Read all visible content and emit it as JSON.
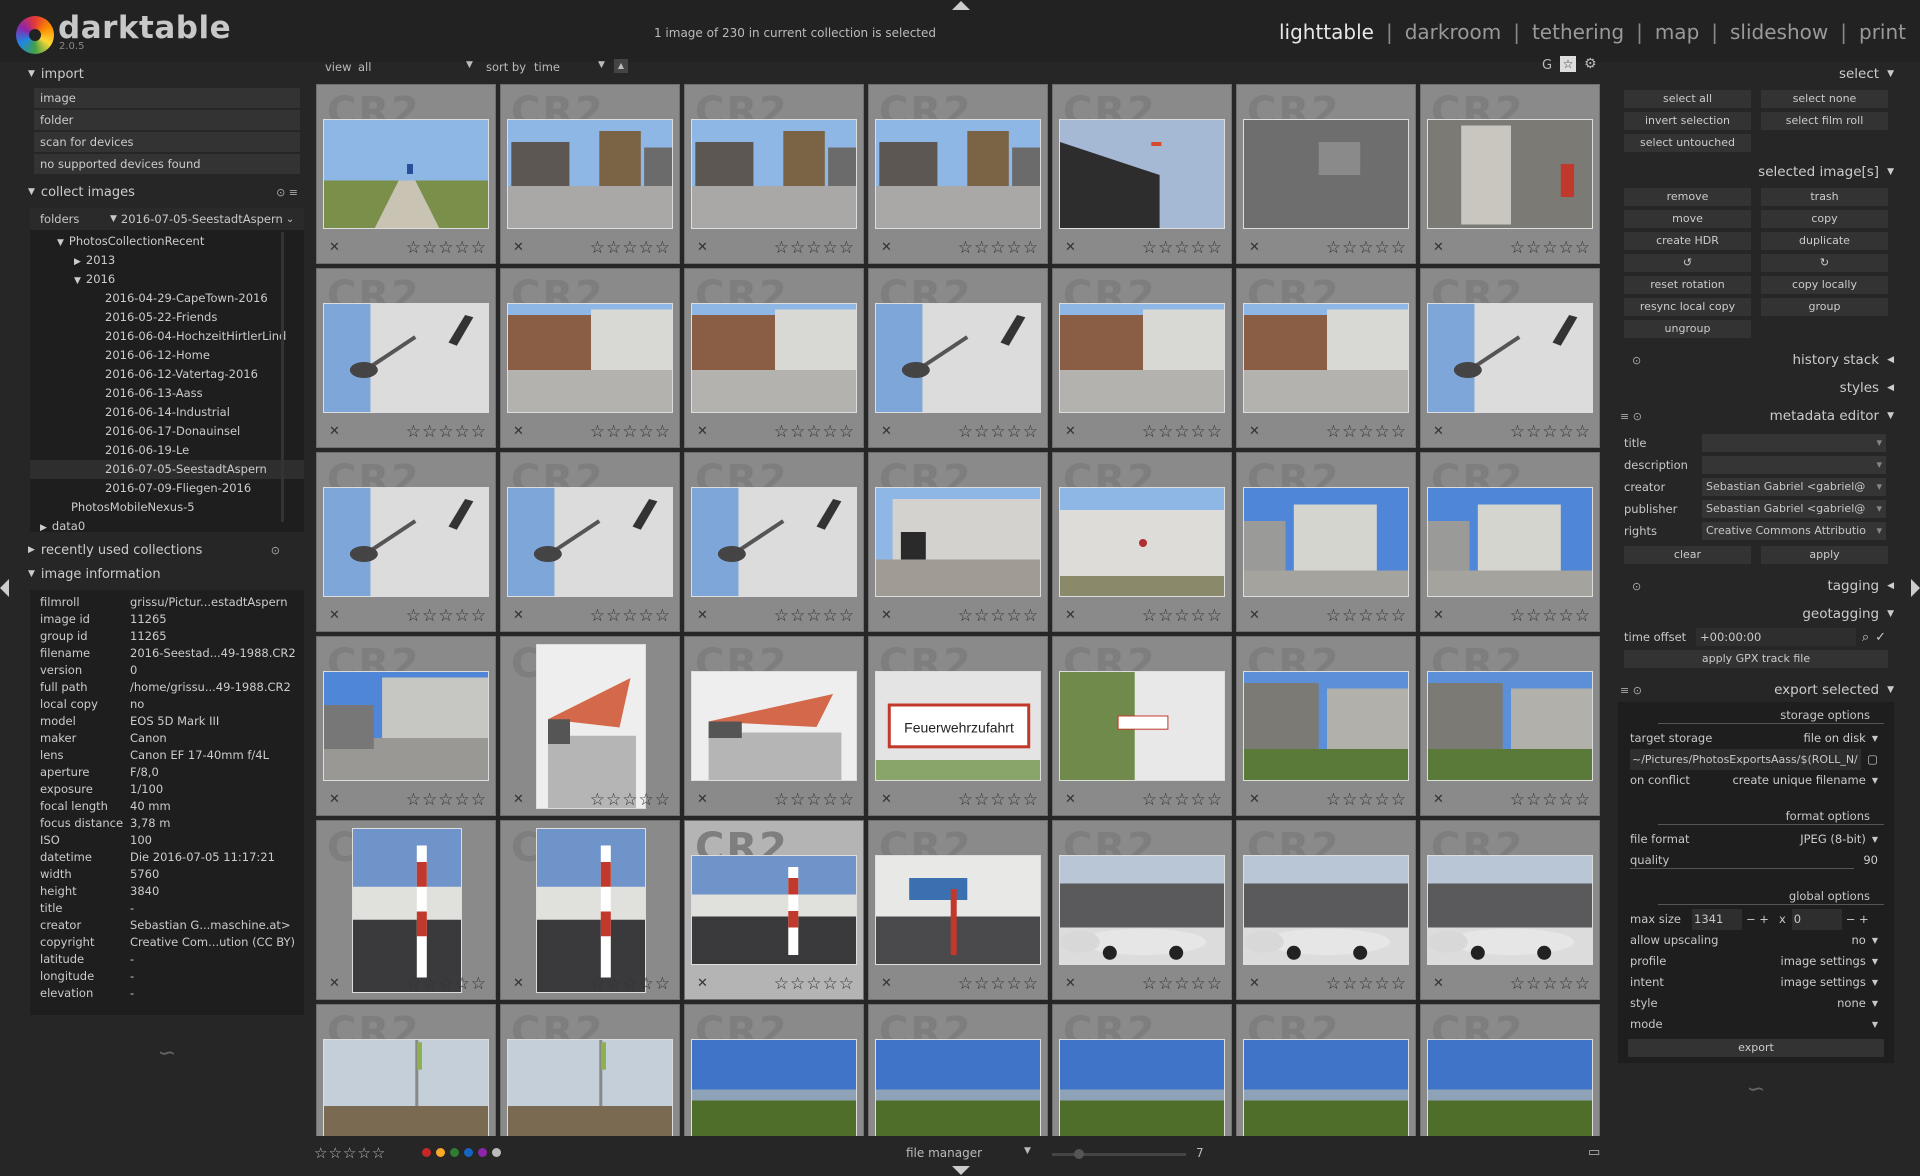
{
  "app": {
    "name": "darktable",
    "version": "2.0.5"
  },
  "status": "1 image of 230 in current collection is selected",
  "views": [
    "lighttable",
    "darkroom",
    "tethering",
    "map",
    "slideshow",
    "print"
  ],
  "active_view": "lighttable",
  "left": {
    "import": {
      "title": "import",
      "buttons": [
        "image",
        "folder",
        "scan for devices",
        "no supported devices found"
      ]
    },
    "collect": {
      "title": "collect images",
      "property": "folders",
      "value": "2016-07-05-SeestadtAspern",
      "tree": [
        {
          "label": "PhotosCollectionRecent",
          "level": 1,
          "arrow": "▼"
        },
        {
          "label": "2013",
          "level": 2,
          "arrow": "▶"
        },
        {
          "label": "2016",
          "level": 2,
          "arrow": "▼"
        },
        {
          "label": "2016-04-29-CapeTown-2016",
          "level": 3,
          "arrow": ""
        },
        {
          "label": "2016-05-22-Friends",
          "level": 3,
          "arrow": ""
        },
        {
          "label": "2016-06-04-HochzeitHirtlerLind",
          "level": 3,
          "arrow": ""
        },
        {
          "label": "2016-06-12-Home",
          "level": 3,
          "arrow": ""
        },
        {
          "label": "2016-06-12-Vatertag-2016",
          "level": 3,
          "arrow": ""
        },
        {
          "label": "2016-06-13-Aass",
          "level": 3,
          "arrow": ""
        },
        {
          "label": "2016-06-14-Industrial",
          "level": 3,
          "arrow": ""
        },
        {
          "label": "2016-06-17-Donauinsel",
          "level": 3,
          "arrow": ""
        },
        {
          "label": "2016-06-19-Le",
          "level": 3,
          "arrow": ""
        },
        {
          "label": "2016-07-05-SeestadtAspern",
          "level": 3,
          "arrow": "",
          "selected": true
        },
        {
          "label": "2016-07-09-Fliegen-2016",
          "level": 3,
          "arrow": ""
        },
        {
          "label": "PhotosMobileNexus-5",
          "level": 1,
          "arrow": ""
        },
        {
          "label": "data0",
          "level": 0,
          "arrow": "▶"
        }
      ]
    },
    "recent": {
      "title": "recently used collections"
    },
    "info": {
      "title": "image information",
      "rows": [
        {
          "k": "filmroll",
          "v": "grissu/Pictur...estadtAspern"
        },
        {
          "k": "image id",
          "v": "11265"
        },
        {
          "k": "group id",
          "v": "11265"
        },
        {
          "k": "filename",
          "v": "2016-Seestad...49-1988.CR2"
        },
        {
          "k": "version",
          "v": "0"
        },
        {
          "k": "full path",
          "v": "/home/grissu...49-1988.CR2"
        },
        {
          "k": "local copy",
          "v": "no"
        },
        {
          "k": "model",
          "v": "EOS 5D Mark III"
        },
        {
          "k": "maker",
          "v": "Canon"
        },
        {
          "k": "lens",
          "v": "Canon EF 17-40mm f/4L"
        },
        {
          "k": "aperture",
          "v": "F/8,0"
        },
        {
          "k": "exposure",
          "v": "1/100"
        },
        {
          "k": "focal length",
          "v": "40 mm"
        },
        {
          "k": "focus distance",
          "v": "3,78 m"
        },
        {
          "k": "ISO",
          "v": "100"
        },
        {
          "k": "datetime",
          "v": "Die 2016-07-05 11:17:21"
        },
        {
          "k": "width",
          "v": "5760"
        },
        {
          "k": "height",
          "v": "3840"
        },
        {
          "k": "title",
          "v": "-"
        },
        {
          "k": "creator",
          "v": "Sebastian G...maschine.at>"
        },
        {
          "k": "copyright",
          "v": "Creative Com...ution (CC BY)"
        },
        {
          "k": "latitude",
          "v": "-"
        },
        {
          "k": "longitude",
          "v": "-"
        },
        {
          "k": "elevation",
          "v": "-"
        }
      ]
    }
  },
  "toolbar": {
    "view_label": "view",
    "view_value": "all",
    "sort_label": "sort by",
    "sort_value": "time",
    "grouping": "G"
  },
  "grid": {
    "columns": 7,
    "watermark": "CR2",
    "thumbs": [
      {
        "scene": "path",
        "orient": "l"
      },
      {
        "scene": "street",
        "orient": "l"
      },
      {
        "scene": "street",
        "orient": "l"
      },
      {
        "scene": "street",
        "orient": "l"
      },
      {
        "scene": "dark",
        "orient": "l"
      },
      {
        "scene": "door",
        "orient": "l"
      },
      {
        "scene": "interior",
        "orient": "l"
      },
      {
        "scene": "lamp",
        "orient": "l"
      },
      {
        "scene": "plaza",
        "orient": "l"
      },
      {
        "scene": "plaza",
        "orient": "l"
      },
      {
        "scene": "lamp",
        "orient": "l"
      },
      {
        "scene": "plaza",
        "orient": "l"
      },
      {
        "scene": "plaza",
        "orient": "l"
      },
      {
        "scene": "lamp",
        "orient": "l"
      },
      {
        "scene": "lamp",
        "orient": "l"
      },
      {
        "scene": "lamp",
        "orient": "l"
      },
      {
        "scene": "lamp",
        "orient": "l"
      },
      {
        "scene": "wall",
        "orient": "l"
      },
      {
        "scene": "wallwhite",
        "orient": "l"
      },
      {
        "scene": "building",
        "orient": "l"
      },
      {
        "scene": "building",
        "orient": "l"
      },
      {
        "scene": "steps",
        "orient": "l"
      },
      {
        "scene": "sail",
        "orient": "p"
      },
      {
        "scene": "sail",
        "orient": "l"
      },
      {
        "scene": "sign",
        "orient": "l"
      },
      {
        "scene": "sign2",
        "orient": "l"
      },
      {
        "scene": "greenbldg",
        "orient": "l"
      },
      {
        "scene": "greenbldg",
        "orient": "l"
      },
      {
        "scene": "pole",
        "orient": "p"
      },
      {
        "scene": "pole",
        "orient": "p"
      },
      {
        "scene": "pole",
        "orient": "l",
        "selected": true
      },
      {
        "scene": "entry",
        "orient": "l"
      },
      {
        "scene": "cars",
        "orient": "l"
      },
      {
        "scene": "cars",
        "orient": "l"
      },
      {
        "scene": "cars",
        "orient": "l"
      },
      {
        "scene": "dirt",
        "orient": "l"
      },
      {
        "scene": "dirt",
        "orient": "l"
      },
      {
        "scene": "field",
        "orient": "l"
      },
      {
        "scene": "field",
        "orient": "l"
      },
      {
        "scene": "field",
        "orient": "l"
      },
      {
        "scene": "field",
        "orient": "l"
      },
      {
        "scene": "field",
        "orient": "l"
      }
    ]
  },
  "bottom": {
    "layout": "file manager",
    "zoom": "7",
    "color_labels": [
      "#c62828",
      "#f9a825",
      "#2e7d32",
      "#1565c0",
      "#8e24aa",
      "#bbbbbb"
    ]
  },
  "right": {
    "select": {
      "title": "select",
      "buttons": [
        "select all",
        "select none",
        "invert selection",
        "select film roll",
        "select untouched"
      ]
    },
    "selected": {
      "title": "selected image[s]",
      "buttons": [
        "remove",
        "trash",
        "move",
        "copy",
        "create HDR",
        "duplicate",
        "↺",
        "↻",
        "reset rotation",
        "copy locally",
        "resync local copy",
        "group",
        "ungroup"
      ]
    },
    "history": {
      "title": "history stack"
    },
    "styles": {
      "title": "styles"
    },
    "metadata": {
      "title": "metadata editor",
      "rows": [
        {
          "k": "title",
          "v": ""
        },
        {
          "k": "description",
          "v": ""
        },
        {
          "k": "creator",
          "v": "Sebastian Gabriel <gabriel@"
        },
        {
          "k": "publisher",
          "v": "Sebastian Gabriel <gabriel@"
        },
        {
          "k": "rights",
          "v": "Creative Commons Attributio"
        }
      ],
      "clear": "clear",
      "apply": "apply"
    },
    "tagging": {
      "title": "tagging"
    },
    "geotagging": {
      "title": "geotagging",
      "offset_label": "time offset",
      "offset_value": "+00:00:00",
      "apply_gpx": "apply GPX track file"
    },
    "export": {
      "title": "export selected",
      "storage_label": "storage options",
      "target_label": "target storage",
      "target_value": "file on disk",
      "path": "~/Pictures/PhotosExportsAass/$(ROLL_N/",
      "conflict_label": "on conflict",
      "conflict_value": "create unique filename",
      "format_label": "format options",
      "file_format_label": "file format",
      "file_format_value": "JPEG (8-bit)",
      "quality_label": "quality",
      "quality_value": "90",
      "global_label": "global options",
      "max_size_label": "max size",
      "max_w": "1341",
      "max_x": "x",
      "max_h": "0",
      "rows": [
        {
          "k": "allow upscaling",
          "v": "no"
        },
        {
          "k": "profile",
          "v": "image settings"
        },
        {
          "k": "intent",
          "v": "image settings"
        },
        {
          "k": "style",
          "v": "none"
        },
        {
          "k": "mode",
          "v": ""
        }
      ],
      "export_button": "export"
    }
  }
}
